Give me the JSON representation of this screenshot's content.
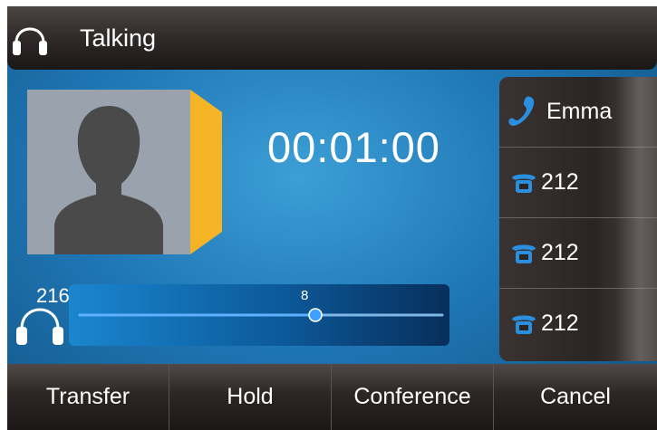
{
  "header": {
    "status": "Talking",
    "icon": "headset-icon"
  },
  "call": {
    "timer": "00:01:00",
    "avatar_icon": "contact-avatar-icon"
  },
  "volume": {
    "line_number": "216",
    "level_label": "8",
    "level_fraction": 0.65,
    "icon": "headset-icon"
  },
  "lines": [
    {
      "label": "Emma",
      "icon": "handset-icon"
    },
    {
      "label": "212",
      "icon": "desk-phone-icon"
    },
    {
      "label": "212",
      "icon": "desk-phone-icon"
    },
    {
      "label": "212",
      "icon": "desk-phone-icon"
    }
  ],
  "softkeys": [
    {
      "label": "Transfer"
    },
    {
      "label": "Hold"
    },
    {
      "label": "Conference"
    },
    {
      "label": "Cancel"
    }
  ],
  "colors": {
    "screen_blue": "#1f77b6",
    "dark_bar": "#2d2827",
    "accent_yellow": "#f5b326",
    "handset_blue": "#2b8fe0"
  }
}
